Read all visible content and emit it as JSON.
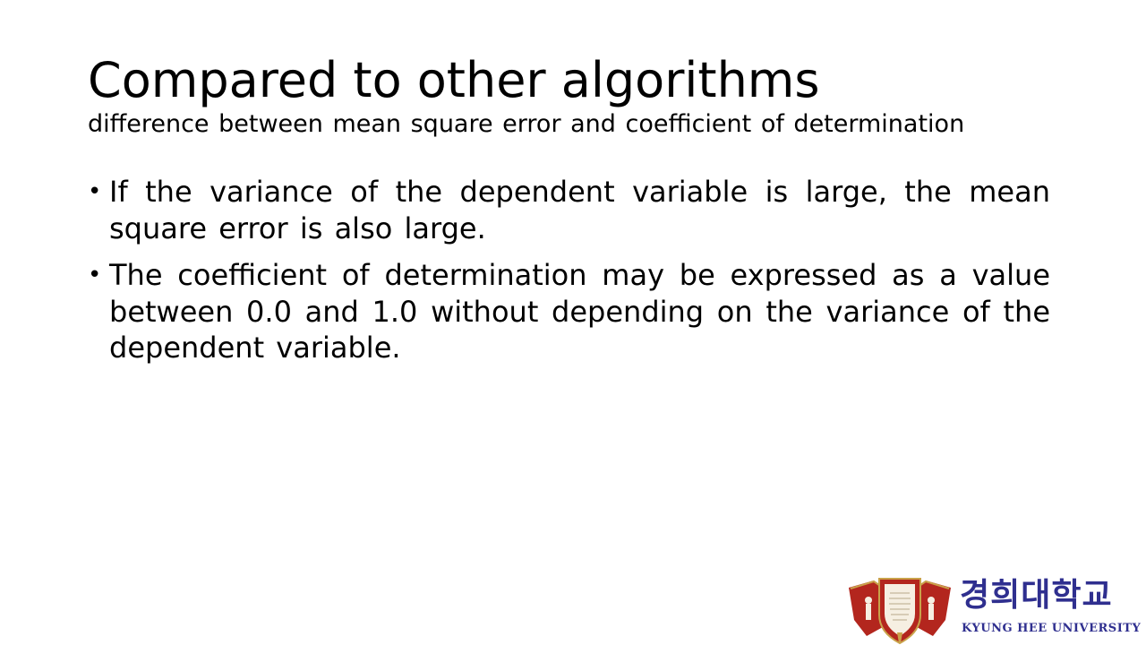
{
  "slide": {
    "title": "Compared to other algorithms",
    "subtitle": "difference between mean square error and coefficient of determination",
    "bullets": [
      {
        "marker": "•",
        "text": "If the variance of the dependent variable is large, the mean square error is also large."
      },
      {
        "marker": "•",
        "text": "The coefficient of determination may be expressed as a value between 0.0 and 1.0 without depending on the variance of the dependent variable."
      }
    ]
  },
  "logo": {
    "name_korean": "경희대학교",
    "name_english": "KYUNG HEE UNIVERSITY",
    "seal_icon": "university-seal-icon",
    "colors": {
      "seal_red": "#b3261e",
      "seal_gold": "#c9a24a",
      "wordmark_blue": "#2f2f8f"
    }
  }
}
